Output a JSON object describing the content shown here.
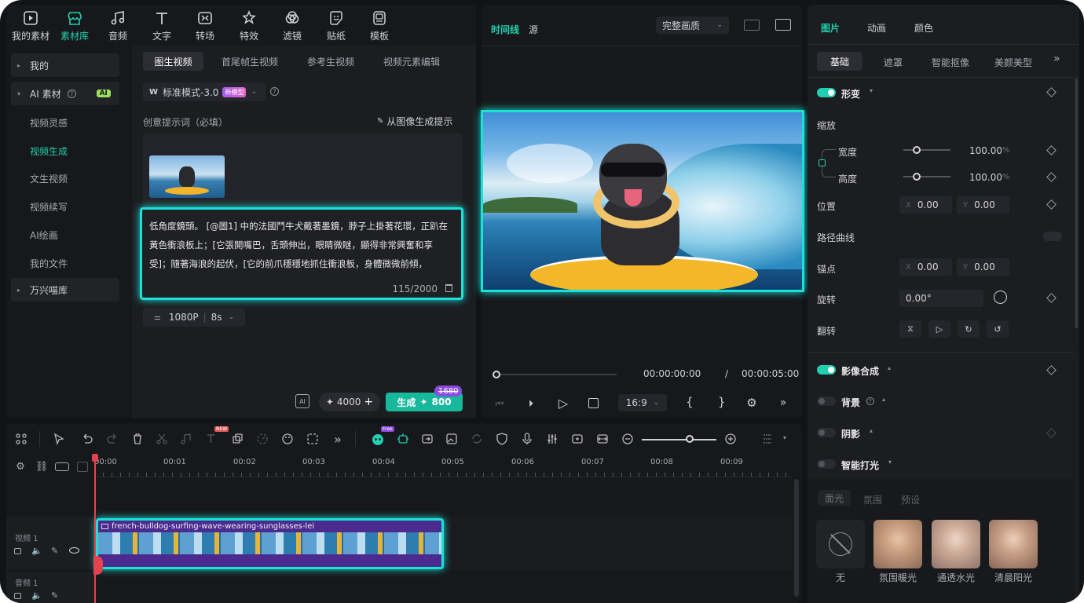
{
  "toolbar": {
    "items": [
      {
        "label": "我的素材",
        "icon": "my-media-icon"
      },
      {
        "label": "素材库",
        "icon": "stock-library-icon"
      },
      {
        "label": "音频",
        "icon": "audio-icon"
      },
      {
        "label": "文字",
        "icon": "text-icon"
      },
      {
        "label": "转场",
        "icon": "transition-icon"
      },
      {
        "label": "特效",
        "icon": "effects-icon"
      },
      {
        "label": "滤镜",
        "icon": "filters-icon"
      },
      {
        "label": "贴纸",
        "icon": "stickers-icon"
      },
      {
        "label": "模板",
        "icon": "templates-icon"
      }
    ]
  },
  "sidebar": {
    "mine": "我的",
    "ai_assets": "AI 素材",
    "ai_badge": "AI",
    "items": [
      "视频灵感",
      "视频生成",
      "文生视频",
      "视频续写",
      "AI绘画",
      "我的文件"
    ],
    "wanxing": "万兴喵库"
  },
  "gen": {
    "tabs": [
      "图生视频",
      "首尾帧生视频",
      "参考生视频",
      "视频元素编辑"
    ],
    "mode": "标准模式-3.0",
    "new_badge": "新模型",
    "prompt_label": "创意提示词（必填）",
    "from_image": "从图像生成提示",
    "prompt_text": "低角度鏡頭。 [@圖1] 中的法國鬥牛犬戴著墨鏡，脖子上掛著花環，正趴在黃色衝浪板上；[它張開嘴巴，舌頭伸出，眼睛微瞇，顯得非常興奮和享受]；隨著海浪的起伏，[它的前爪穩穩地抓住衝浪板，身體微微前傾，",
    "char_count": "115/2000",
    "resolution": "1080P",
    "duration": "8s",
    "credits": "4000",
    "generate_label": "生成",
    "generate_cost": "800",
    "old_cost": "1680"
  },
  "preview": {
    "tab_timeline": "时间线",
    "tab_source": "源",
    "quality": "完整画质",
    "time_current": "00:00:00:00",
    "time_sep": "/",
    "time_total": "00:00:05:00",
    "aspect": "16:9",
    "brace_open": "{",
    "brace_close": "}"
  },
  "props": {
    "tabs": [
      "图片",
      "动画",
      "颜色"
    ],
    "subtabs": [
      "基础",
      "遮罩",
      "智能抠像",
      "美颜美型"
    ],
    "transform": "形变",
    "scale": "缩放",
    "width": "宽度",
    "width_val": "100.00",
    "height": "高度",
    "height_val": "100.00",
    "percent": "%",
    "position": "位置",
    "pos_x": "0.00",
    "pos_y": "0.00",
    "axis_x": "X",
    "axis_y": "Y",
    "path_curve": "路径曲线",
    "anchor": "锚点",
    "anchor_x": "0.00",
    "anchor_y": "0.00",
    "rotate": "旋转",
    "rotate_val": "0.00°",
    "flip": "翻转",
    "compositing": "影像合成",
    "background": "背景",
    "shadow": "阴影",
    "smart_light": "智能打光",
    "light_tabs": [
      "面光",
      "氛围",
      "预设"
    ],
    "light_presets": [
      "无",
      "氛围暖光",
      "通透水光",
      "清晨阳光"
    ]
  },
  "timeline": {
    "ruler": [
      "00:00",
      "00:01",
      "00:02",
      "00:03",
      "00:04",
      "00:05",
      "00:06",
      "00:07",
      "00:08",
      "00:09"
    ],
    "video_track": "视频 1",
    "audio_track": "音频 1",
    "clip_name": "french-bulldog-surfing-wave-wearing-sunglasses-lei",
    "free_badge": "Free",
    "new_badge": "NEW"
  },
  "colors": {
    "accent": "#21d0b1",
    "highlight": "#19e3d9",
    "clip": "#4b2b8f",
    "playhead": "#e2434e"
  }
}
